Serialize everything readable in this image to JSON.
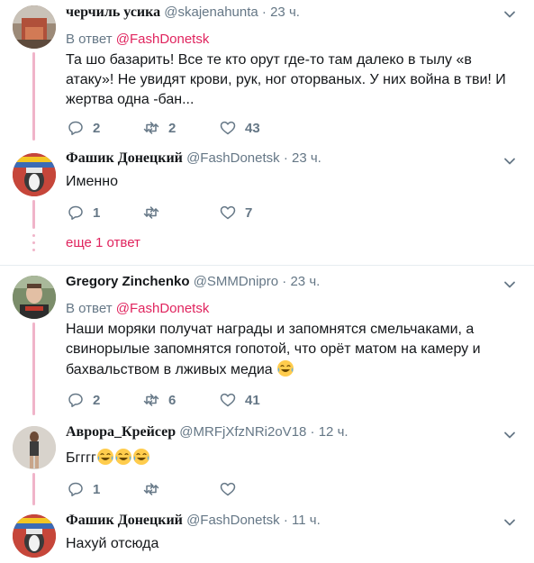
{
  "tweets": [
    {
      "name": "черчиль усика",
      "handle": "@skajenahunta",
      "dot": "·",
      "time": "23 ч.",
      "reply_prefix": "В ответ",
      "reply_to": "@FashDonetsk",
      "text": "Та шо базарить! Все те кто орут где-то там далеко в тылу «в атаку»! Не увидят крови, рук, ног оторваных. У них война в тви! И жертва одна -бан...",
      "replies": "2",
      "retweets": "2",
      "likes": "43"
    },
    {
      "name": "Фашик Донецкий",
      "handle": "@FashDonetsk",
      "dot": "·",
      "time": "23 ч.",
      "text": "Именно",
      "replies": "1",
      "retweets": "",
      "likes": "7"
    },
    {
      "name": "Gregory Zinchenko",
      "handle": "@SMMDnipro",
      "dot": "·",
      "time": "23 ч.",
      "reply_prefix": "В ответ",
      "reply_to": "@FashDonetsk",
      "text": "Наши моряки получат награды и запомнятся смельчаками, а свинорылые запомнятся гопотой, что орёт матом на камеру и бахвальством в лживых медиа",
      "replies": "2",
      "retweets": "6",
      "likes": "41"
    },
    {
      "name": "Аврора_Крейсер",
      "handle": "@MRFjXfzNRi2oV18",
      "dot": "·",
      "time": "12 ч.",
      "text": "Бгггг",
      "replies": "1",
      "retweets": "",
      "likes": ""
    },
    {
      "name": "Фашик Донецкий",
      "handle": "@FashDonetsk",
      "dot": "·",
      "time": "11 ч.",
      "text": "Нахуй отсюда"
    }
  ],
  "more_replies_label": "еще 1 ответ",
  "icons": {
    "reply": "reply-icon",
    "retweet": "retweet-icon",
    "like": "heart-icon",
    "menu": "chevron-down-icon",
    "emoji": "face-with-tears-of-joy-emoji"
  },
  "colors": {
    "link": "#e0245e",
    "secondary_text": "#657786",
    "thread_line": "#f0b4c9",
    "divider": "#e6ecf0"
  }
}
